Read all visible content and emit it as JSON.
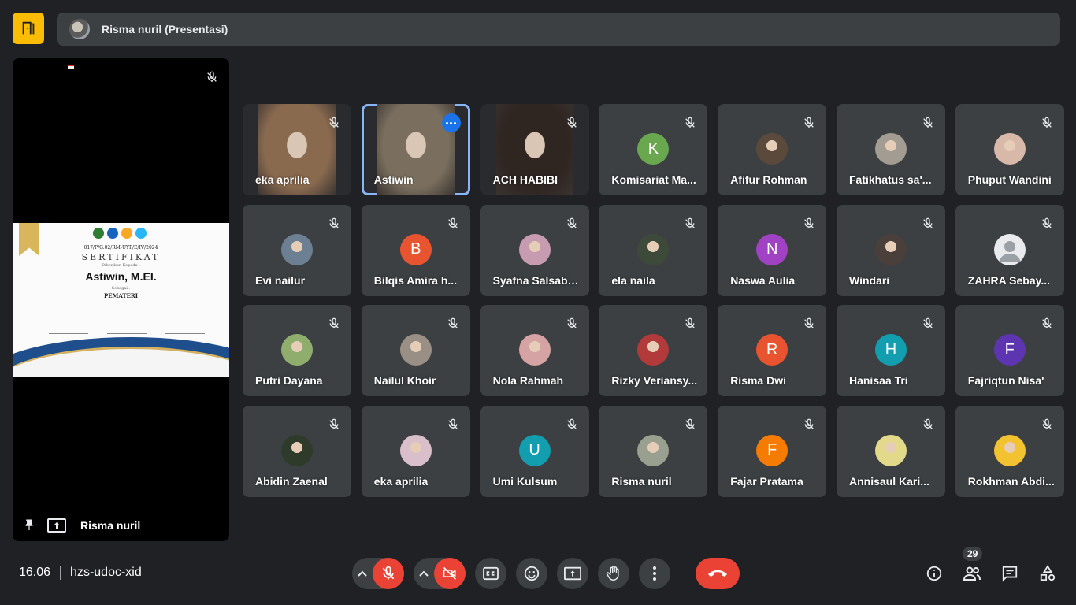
{
  "presentation": {
    "title": "Risma nuril (Presentasi)",
    "presenter": "Risma nuril",
    "certificate": {
      "number": "017/P/G.02/RM-UYP/E/IV/2024",
      "heading": "SERTIFIKAT",
      "given_to": "Diberikan Kepada :",
      "name": "Astiwin, M.EI.",
      "as_label": "Sebagai :",
      "role": "PEMATERI"
    }
  },
  "participants": [
    {
      "name": "eka aprilia",
      "type": "video",
      "bg": "#8a6a4f"
    },
    {
      "name": "Astiwin",
      "type": "video",
      "bg": "#7a6f5e",
      "active": true
    },
    {
      "name": "ACH HABIBI",
      "type": "video",
      "bg": "#2f2622"
    },
    {
      "name": "Komisariat Ma...",
      "type": "letter",
      "letter": "K",
      "color": "#6aa84f"
    },
    {
      "name": "Afifur Rohman",
      "type": "photo",
      "color": "#5b4a3c"
    },
    {
      "name": "Fatikhatus sa'...",
      "type": "photo",
      "color": "#a39c93"
    },
    {
      "name": "Phuput Wandini",
      "type": "photo",
      "color": "#d8b8a8"
    },
    {
      "name": "Evi nailur",
      "type": "photo",
      "color": "#6d7f93"
    },
    {
      "name": "Bilqis Amira h...",
      "type": "letter",
      "letter": "B",
      "color": "#e8542f"
    },
    {
      "name": "Syafna Salsabila",
      "type": "photo",
      "color": "#c79bb0"
    },
    {
      "name": "ela naila",
      "type": "photo",
      "color": "#3d4a3a"
    },
    {
      "name": "Naswa Aulia",
      "type": "letter",
      "letter": "N",
      "color": "#a142c4"
    },
    {
      "name": "Windari",
      "type": "photo",
      "color": "#4a3f3a"
    },
    {
      "name": "ZAHRA Sebay...",
      "type": "default",
      "color": "#e8eaed"
    },
    {
      "name": "Putri Dayana",
      "type": "photo",
      "color": "#8fae6d"
    },
    {
      "name": "Nailul Khoir",
      "type": "photo",
      "color": "#9a8f84"
    },
    {
      "name": "Nola Rahmah",
      "type": "photo",
      "color": "#d5a3a3"
    },
    {
      "name": "Rizky Veriansy...",
      "type": "photo",
      "color": "#b23a3a"
    },
    {
      "name": "Risma Dwi",
      "type": "letter",
      "letter": "R",
      "color": "#e8542f"
    },
    {
      "name": "Hanisaa Tri",
      "type": "letter",
      "letter": "H",
      "color": "#129eaf"
    },
    {
      "name": "Fajriqtun Nisa'",
      "type": "letter",
      "letter": "F",
      "color": "#5e35b1"
    },
    {
      "name": "Abidin Zaenal",
      "type": "photo",
      "color": "#2e3a2a"
    },
    {
      "name": "eka aprilia",
      "type": "photo",
      "color": "#d9bfc9"
    },
    {
      "name": "Umi Kulsum",
      "type": "letter",
      "letter": "U",
      "color": "#129eaf"
    },
    {
      "name": "Risma nuril",
      "type": "photo",
      "color": "#9aa08f"
    },
    {
      "name": "Fajar Pratama",
      "type": "letter",
      "letter": "F",
      "color": "#f57c00"
    },
    {
      "name": "Annisaul Kari...",
      "type": "photo",
      "color": "#e3d98a"
    },
    {
      "name": "Rokhman Abdi...",
      "type": "photo",
      "color": "#f2c230"
    }
  ],
  "footer": {
    "time": "16.06",
    "meeting_code": "hzs-udoc-xid",
    "participant_count": "29"
  },
  "colors": {
    "background": "#202124",
    "tile": "#3c4043",
    "accent_yellow": "#fbbc04",
    "danger": "#ea4335",
    "active_outline": "#8ab4f8"
  }
}
